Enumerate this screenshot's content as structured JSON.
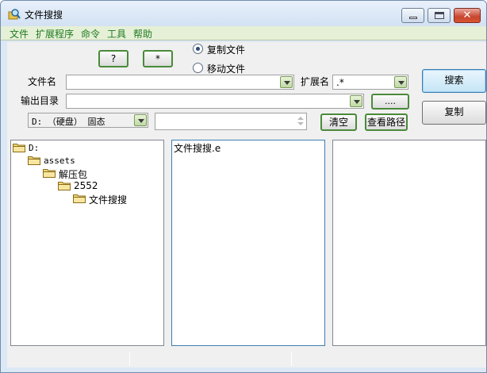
{
  "window": {
    "title": "文件搜搜"
  },
  "menu": [
    "文件",
    "扩展程序",
    "命令",
    "工具",
    "帮助"
  ],
  "toolbar": {
    "question_label": "?",
    "star_label": "*"
  },
  "options": {
    "copy_label": "复制文件",
    "move_label": "移动文件",
    "selected": "copy"
  },
  "form": {
    "filename_label": "文件名",
    "filename_value": "",
    "ext_label": "扩展名",
    "ext_value": ".*",
    "output_label": "输出目录",
    "output_value": "",
    "browse_label": "....",
    "drive_value": "D: （硬盘） 固态",
    "spin_value": "",
    "clear_label": "清空",
    "view_path_label": "查看路径"
  },
  "actions": {
    "search_label": "搜索",
    "copy_label": "复制"
  },
  "tree": [
    {
      "label": "D:",
      "depth": 0,
      "mono": true
    },
    {
      "label": "assets",
      "depth": 1,
      "mono": true
    },
    {
      "label": "解压包",
      "depth": 2,
      "mono": false
    },
    {
      "label": "2552",
      "depth": 3,
      "mono": false
    },
    {
      "label": "文件搜搜",
      "depth": 4,
      "mono": false
    }
  ],
  "file_list": [
    "文件搜搜.e"
  ],
  "icons": {
    "app": "magnifier-folder-icon",
    "folder": "folder-icon"
  },
  "colors": {
    "menu_text": "#1f7a1f",
    "accent_border": "#4a8a3a"
  }
}
